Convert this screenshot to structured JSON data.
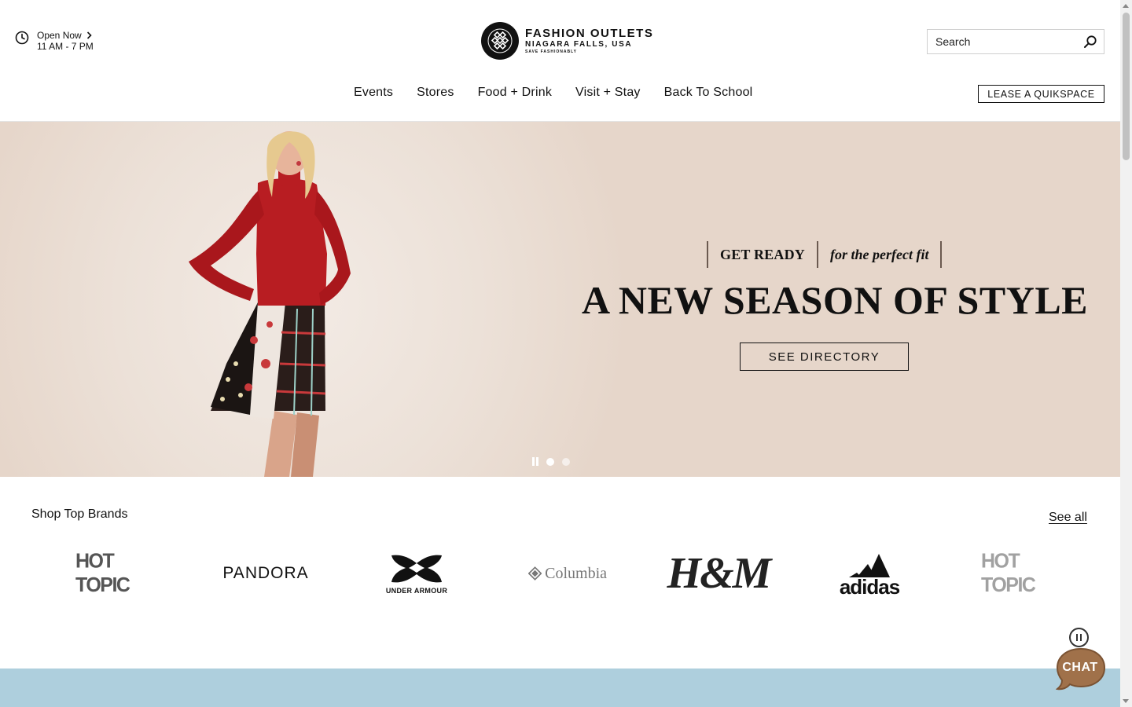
{
  "header": {
    "hours_status": "Open Now",
    "hours_range": "11 AM - 7 PM",
    "logo_line1": "FASHION OUTLETS",
    "logo_line2": "NIAGARA FALLS, USA",
    "logo_line3": "SAVE FASHIONABLY",
    "search_placeholder": "Search",
    "nav": [
      "Events",
      "Stores",
      "Food + Drink",
      "Visit + Stay",
      "Back To School"
    ],
    "lease_button": "LEASE A QUIKSPACE"
  },
  "hero": {
    "tag_left": "GET READY",
    "tag_right": "for the perfect fit",
    "headline": "A NEW SEASON OF STYLE",
    "cta": "SEE DIRECTORY",
    "slide_count": 2,
    "active_slide": 1
  },
  "brands": {
    "title": "Shop Top Brands",
    "see_all": "See all",
    "logos": [
      "HOT TOPIC",
      "PANDORA",
      "UNDER ARMOUR",
      "Columbia",
      "H&M",
      "adidas",
      "HOT TOPIC"
    ]
  },
  "chat": {
    "label": "CHAT"
  },
  "colors": {
    "hero_bg": "#e8dbd0",
    "band": "#aecfdd",
    "chat_bubble": "#a0714a"
  },
  "icons": [
    "clock-icon",
    "chevron-right-icon",
    "search-icon",
    "pause-icon"
  ]
}
